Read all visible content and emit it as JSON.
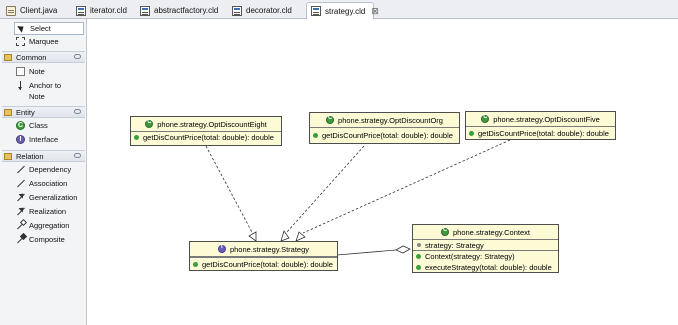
{
  "tabs": [
    {
      "label": "Client.java",
      "icon": "java-file-icon",
      "active": false
    },
    {
      "label": "iterator.cld",
      "icon": "class-diagram-file-icon",
      "active": false
    },
    {
      "label": "abstractfactory.cld",
      "icon": "class-diagram-file-icon",
      "active": false
    },
    {
      "label": "decorator.cld",
      "icon": "class-diagram-file-icon",
      "active": false
    },
    {
      "label": "strategy.cld",
      "icon": "class-diagram-file-icon",
      "active": true,
      "close_glyph": "⊠"
    }
  ],
  "palette": {
    "tools": {
      "select": "Select",
      "marquee": "Marquee"
    },
    "drawers": {
      "common": "Common",
      "entity": "Entity",
      "relation": "Relation"
    },
    "common": {
      "note": "Note",
      "anchor_line1": "Anchor to",
      "anchor_line2": "Note"
    },
    "entity": {
      "class": "Class",
      "interface": "Interface"
    },
    "relation": {
      "dependency": "Dependency",
      "association": "Association",
      "generalization": "Generalization",
      "realization": "Realization",
      "aggregation": "Aggregation",
      "composite": "Composite"
    }
  },
  "diagram": {
    "classes": {
      "eight": {
        "name": "phone.strategy.OptDiscountEight",
        "kind": "class",
        "method": "getDisCountPrice(total: double): double"
      },
      "org": {
        "name": "phone.strategy.OptDiscountOrg",
        "kind": "class",
        "method": "getDisCountPrice(total: double): double"
      },
      "five": {
        "name": "phone.strategy.OptDiscountFive",
        "kind": "class",
        "method": "getDisCountPrice(total: double): double"
      },
      "strategy": {
        "name": "phone.strategy.Strategy",
        "kind": "interface",
        "method": "getDisCountPrice(total: double): double"
      },
      "context": {
        "name": "phone.strategy.Context",
        "kind": "class",
        "field": "strategy: Strategy",
        "constructor": "Context(strategy: Strategy)",
        "method": "executeStrategy(total: double): double"
      }
    },
    "relations": [
      {
        "from": "phone.strategy.OptDiscountEight",
        "to": "phone.strategy.Strategy",
        "type": "realization"
      },
      {
        "from": "phone.strategy.OptDiscountOrg",
        "to": "phone.strategy.Strategy",
        "type": "realization"
      },
      {
        "from": "phone.strategy.OptDiscountFive",
        "to": "phone.strategy.Strategy",
        "type": "realization"
      },
      {
        "from": "phone.strategy.Context",
        "to": "phone.strategy.Strategy",
        "type": "aggregation"
      }
    ]
  },
  "colors": {
    "class_fill": "#fdfbd6",
    "class_border": "#4d4d4d",
    "class_icon": "#3d9a3d",
    "interface_icon": "#6a5fb8"
  }
}
